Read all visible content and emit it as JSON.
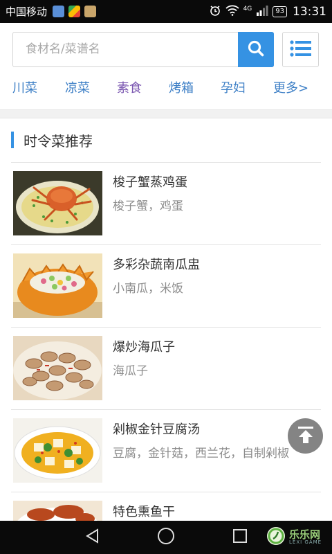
{
  "status_bar": {
    "carrier": "中国移动",
    "network": "4G",
    "battery": "93",
    "time": "13:31"
  },
  "search": {
    "placeholder": "食材名/菜谱名",
    "search_icon": "search-icon",
    "menu_icon": "list-icon"
  },
  "categories": [
    {
      "label": "川菜",
      "color": "#3d7fc6"
    },
    {
      "label": "凉菜",
      "color": "#3d7fc6"
    },
    {
      "label": "素食",
      "color": "#7a56b0"
    },
    {
      "label": "烤箱",
      "color": "#3d7fc6"
    },
    {
      "label": "孕妇",
      "color": "#3d7fc6"
    },
    {
      "label": "更多>",
      "color": "#3d7fc6"
    }
  ],
  "section": {
    "title": "时令菜推荐"
  },
  "recipes": [
    {
      "name": "梭子蟹蒸鸡蛋",
      "ingredients": "梭子蟹，鸡蛋"
    },
    {
      "name": "多彩杂蔬南瓜盅",
      "ingredients": "小南瓜，米饭"
    },
    {
      "name": "爆炒海瓜子",
      "ingredients": "海瓜子"
    },
    {
      "name": "剁椒金针豆腐汤",
      "ingredients": "豆腐，金针菇，西兰花，自制剁椒"
    },
    {
      "name": "特色熏鱼干",
      "ingredients": ""
    }
  ],
  "watermark": {
    "text": "乐乐网",
    "sub": "LEXI GAME"
  },
  "colors": {
    "accent": "#3592e3",
    "link": "#3d7fc6"
  }
}
